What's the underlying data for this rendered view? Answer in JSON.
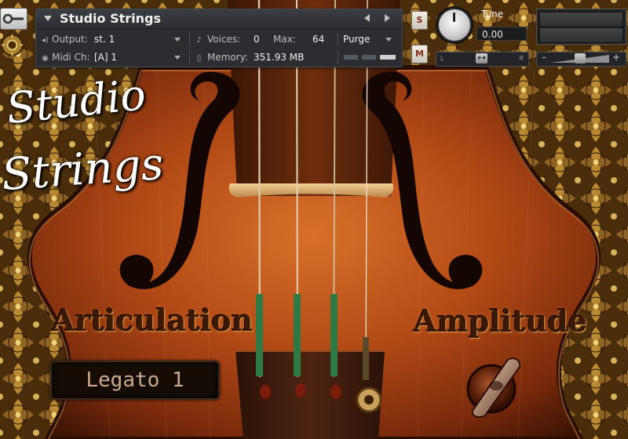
{
  "header": {
    "title": "Studio Strings",
    "output_label": "Output:",
    "output_value": "st. 1",
    "voices_label": "Voices:",
    "voices_value": "0",
    "max_label": "Max:",
    "max_value": "64",
    "purge_label": "Purge",
    "midi_label": "Midi Ch:",
    "midi_value": "[A]  1",
    "memory_label": "Memory:",
    "memory_value": "351.93 MB"
  },
  "controls": {
    "solo_label": "S",
    "mute_label": "M",
    "tune_label": "Tune",
    "tune_value": "0.00",
    "pan_left": "L",
    "pan_right": "R",
    "vol_minus": "–",
    "vol_plus": "+"
  },
  "instrument": {
    "logo_line1": "Studio",
    "logo_line2": "Strings",
    "articulation_title": "Articulation",
    "amplitude_title": "Amplitude",
    "articulation_value": "Legato 1"
  },
  "icons": {
    "output": "speaker-icon",
    "voices": "voices-icon",
    "midi": "midi-icon",
    "memory": "memory-icon",
    "tools": "wrench-icon",
    "settings": "gear-icon"
  }
}
